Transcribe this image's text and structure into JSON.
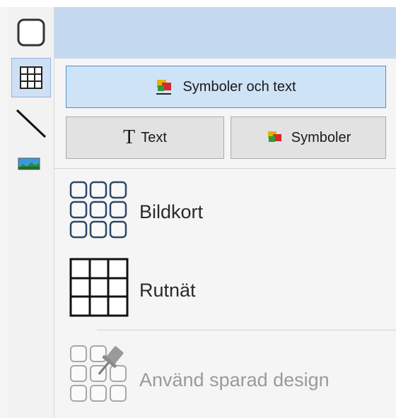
{
  "toolbar": {
    "tools": [
      {
        "name": "rounded-rectangle-tool",
        "icon": "rounded-square-icon"
      },
      {
        "name": "grid-tool",
        "icon": "grid-icon",
        "active": true
      },
      {
        "name": "line-tool",
        "icon": "diagonal-line-icon"
      },
      {
        "name": "image-tool",
        "icon": "landscape-image-icon"
      }
    ]
  },
  "panel": {
    "primary_button": {
      "label": "Symboler och text",
      "icon": "symbols-text-icon"
    },
    "text_button": {
      "label": "Text",
      "icon": "T"
    },
    "symbols_button": {
      "label": "Symboler",
      "icon": "symbols-icon"
    },
    "options": [
      {
        "label": "Bildkort",
        "icon": "card-grid-icon"
      },
      {
        "label": "Rutnät",
        "icon": "table-grid-icon"
      },
      {
        "label": "Använd sparad design",
        "icon": "saved-design-pin-icon",
        "disabled": true
      }
    ]
  },
  "colors": {
    "header": "#c5d9f1",
    "primary_button_bg": "#cfe3f7",
    "primary_button_border": "#4f8fd0",
    "secondary_button_bg": "#e2e2e2",
    "disabled_text": "#9a9a9a"
  }
}
